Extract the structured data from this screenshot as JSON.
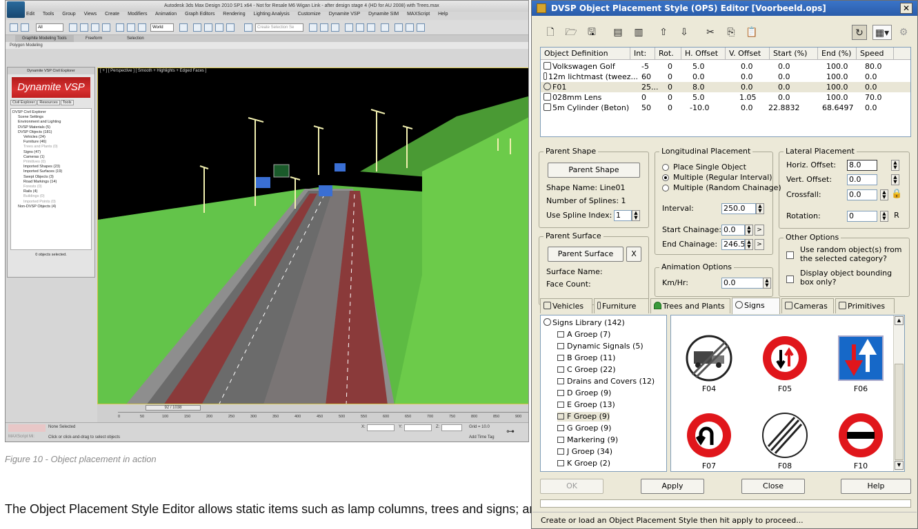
{
  "left_screenshot": {
    "title": "Autodesk 3ds Max Design 2010 SP1 x64 - Not for Resale   M6 Wigan Link - after design stage 4 (HD for AU 2008) with Trees.max",
    "menu": [
      "Edit",
      "Tools",
      "Group",
      "Views",
      "Create",
      "Modifiers",
      "Animation",
      "Graph Editors",
      "Rendering",
      "Lighting Analysis",
      "Customize",
      "Dynamite VSP",
      "Dynamite SIM",
      "MAXScript",
      "Help"
    ],
    "toolbar": {
      "select_filter": "All",
      "ref_coord": "World",
      "selection_set": "Create Selection Se"
    },
    "ribbon_tabs": [
      "Graphite Modeling Tools",
      "Freeform",
      "Selection"
    ],
    "ribbon_panel": "Polygon Modeling",
    "viewport_label": "[ + ] [ Perspective ] [ Smooth + Highlights + Edged Faces ]",
    "civil_explorer": {
      "title": "Dynamite VSP Civil Explorer",
      "brand": "Dynamite VSP",
      "tabs": [
        "Civil Explorer",
        "Resources",
        "Tools"
      ],
      "tree": [
        "DVSP Civil Explorer",
        "Scene Settings",
        "Environment and Lighting",
        "DVSP Materials (5)",
        "DVSP Objects (181)",
        "Vehicles (24)",
        "Furniture (46)",
        "Trees and Plants (0)",
        "Signs (47)",
        "Cameras (1)",
        "Primitives (0)",
        "Imported Shapes (23)",
        "Imported Surfaces (19)",
        "Swept Objects (3)",
        "Road Markings (14)",
        "Forests (0)",
        "Rails (4)",
        "Buildings (0)",
        "Imported Points (0)",
        "Non-DVSP Objects (4)"
      ],
      "footer": "0 objects selected."
    },
    "timeline": {
      "slider": "92 / 1038",
      "ticks": [
        "0",
        "50",
        "100",
        "150",
        "200",
        "250",
        "300",
        "350",
        "400",
        "450",
        "500",
        "550",
        "600",
        "650",
        "700",
        "750",
        "800",
        "850",
        "900"
      ]
    },
    "status": {
      "none_selected": "None Selected",
      "prompt": "Click or click-and-drag to select objects",
      "maxscript": "MAXScript Mi:",
      "x": "X:",
      "y": "Y:",
      "z": "Z:",
      "grid": "Grid = 10.0",
      "add_time_tag": "Add Time Tag"
    }
  },
  "caption": "Figure 10 - Object placement in action",
  "paragraph": "The Object Placement Style Editor allows static items such as lamp columns, trees and signs; and animated objects such as cameras and",
  "editor": {
    "title": "DVSP Object Placement Style (OPS) Editor [Voorbeeld.ops]",
    "close": "✕",
    "columns": [
      "Object Definition",
      "Int:",
      "Rot.",
      "H. Offset",
      "V. Offset",
      "Start (%)",
      "End (%)",
      "Speed"
    ],
    "rows": [
      {
        "name": "Volkswagen Golf",
        "int": "-5",
        "rot": "0",
        "h": "5.0",
        "v": "0.0",
        "start": "0.0",
        "end": "100.0",
        "speed": "80.0"
      },
      {
        "name": "12m lichtmast (tweez...",
        "int": "60",
        "rot": "0",
        "h": "0.0",
        "v": "0.0",
        "start": "0.0",
        "end": "100.0",
        "speed": "0.0"
      },
      {
        "name": "F01",
        "int": "25...",
        "rot": "0",
        "h": "8.0",
        "v": "0.0",
        "start": "0.0",
        "end": "100.0",
        "speed": "0.0"
      },
      {
        "name": "028mm Lens",
        "int": "0",
        "rot": "0",
        "h": "5.0",
        "v": "1.05",
        "start": "0.0",
        "end": "100.0",
        "speed": "70.0"
      },
      {
        "name": "5m Cylinder (Beton)",
        "int": "50",
        "rot": "0",
        "h": "-10.0",
        "v": "0.0",
        "start": "22.8832",
        "end": "68.6497",
        "speed": "0.0"
      }
    ],
    "parent_shape": {
      "legend": "Parent Shape",
      "button": "Parent Shape",
      "shape_name": "Shape Name: Line01",
      "splines": "Number of Splines: 1",
      "use_spline": "Use Spline Index:",
      "spline_index": "1"
    },
    "parent_surface": {
      "legend": "Parent Surface",
      "button": "Parent Surface",
      "clear": "X",
      "surface_name": "Surface Name:",
      "face_count": "Face Count:"
    },
    "longitudinal": {
      "legend": "Longitudinal Placement",
      "opt_single": "Place Single Object",
      "opt_regular": "Multiple (Regular Interval)",
      "opt_random": "Multiple (Random Chainage)",
      "interval_label": "Interval:",
      "interval": "250.0",
      "start_label": "Start Chainage:",
      "start": "0.0",
      "end_label": "End Chainage:",
      "end": "246.539"
    },
    "animation": {
      "legend": "Animation Options",
      "kmhr_label": "Km/Hr:",
      "kmhr": "0.0"
    },
    "lateral": {
      "legend": "Lateral Placement",
      "horiz_label": "Horiz. Offset:",
      "horiz": "8.0",
      "vert_label": "Vert. Offset:",
      "vert": "0.0",
      "crossfall_label": "Crossfall:",
      "crossfall": "0.0",
      "rotation_label": "Rotation:",
      "rotation": "0",
      "r_btn": "R"
    },
    "other": {
      "legend": "Other Options",
      "random": "Use random object(s) from the selected category?",
      "random_1": "Use random object(s) from",
      "random_2": "the selected category?",
      "bbox_1": "Display object bounding",
      "bbox_2": "box only?"
    },
    "category_tabs": [
      "Vehicles",
      "Furniture",
      "Trees and Plants",
      "Signs",
      "Cameras",
      "Primitives"
    ],
    "library": [
      "Signs Library (142)",
      "A Groep (7)",
      "Dynamic Signals (5)",
      "B Groep (11)",
      "C Groep (22)",
      "Drains and Covers (12)",
      "D Groep (9)",
      "E Groep (13)",
      "F Groep (9)",
      "G Groep (9)",
      "Markering (9)",
      "J Groep (34)",
      "K Groep (2)"
    ],
    "signs": [
      "F04",
      "F05",
      "F06",
      "F07",
      "F08",
      "F10"
    ],
    "buttons": {
      "ok": "OK",
      "apply": "Apply",
      "close": "Close",
      "help": "Help"
    },
    "status": "Create or load an Object Placement Style then hit apply to proceed..."
  }
}
